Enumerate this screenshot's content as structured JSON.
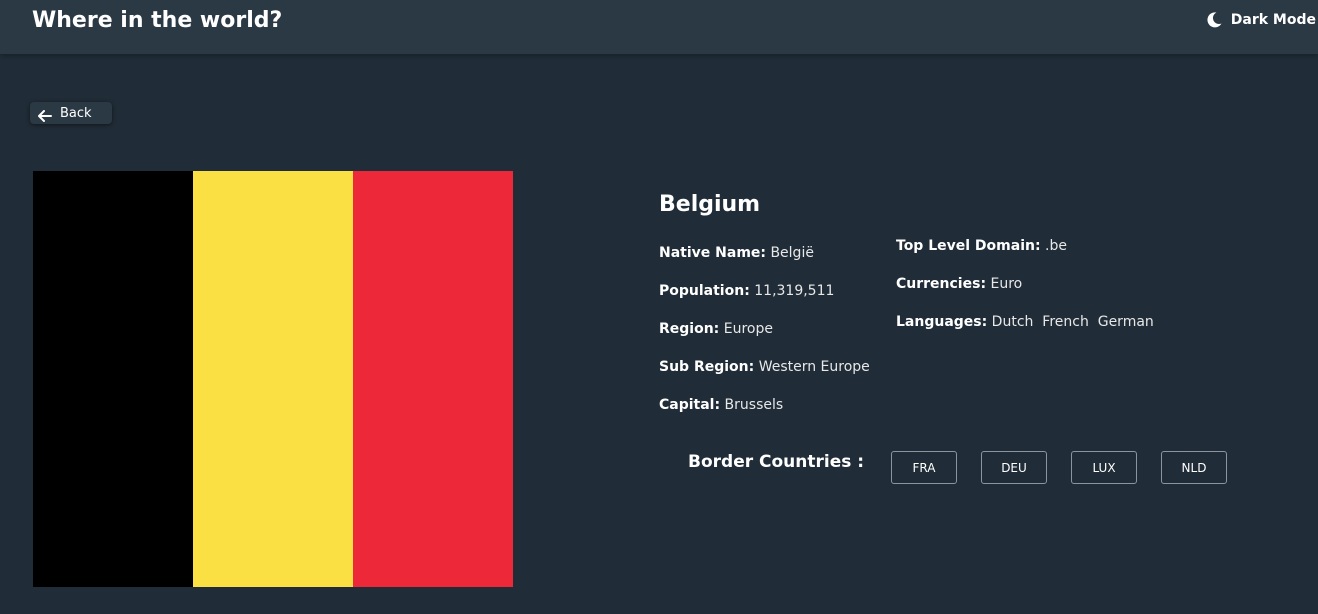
{
  "header": {
    "title": "Where in the world?",
    "dark_mode_label": "Dark Mode",
    "dark_mode_icon": "moon-icon"
  },
  "back_button": {
    "label": "Back",
    "icon": "arrow-left-icon"
  },
  "flag": {
    "colors": [
      "#000000",
      "#fae042",
      "#ed2939"
    ]
  },
  "country": {
    "name": "Belgium",
    "left_info": [
      {
        "key": "Native Name:",
        "value": "België"
      },
      {
        "key": "Population:",
        "value": "11,319,511"
      },
      {
        "key": "Region:",
        "value": "Europe"
      },
      {
        "key": "Sub Region:",
        "value": "Western Europe"
      },
      {
        "key": "Capital:",
        "value": "Brussels"
      }
    ],
    "right_info": [
      {
        "key": "Top Level Domain:",
        "value": ".be"
      },
      {
        "key": "Currencies:",
        "value": "Euro"
      },
      {
        "key": "Languages:",
        "value": "Dutch  French  German"
      }
    ]
  },
  "borders": {
    "label": "Border Countries :",
    "countries": [
      "FRA",
      "DEU",
      "LUX",
      "NLD"
    ]
  },
  "colors": {
    "background": "#202c37",
    "header": "#2b3945",
    "text": "#ffffff"
  }
}
